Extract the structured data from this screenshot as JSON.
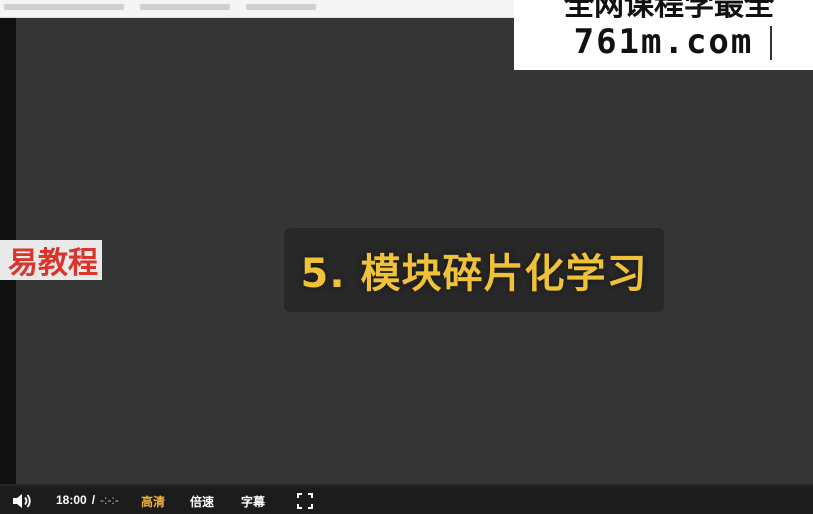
{
  "slide": {
    "title": "5. 模块碎片化学习"
  },
  "watermarks": {
    "left_text": "易教程",
    "right_top_text": "全网课程学最全",
    "right_bottom_text": "761m.com"
  },
  "controls": {
    "volume_icon": "speaker-icon",
    "current_time": "18:00",
    "separator": "/",
    "duration": "-:-:-",
    "quality_label": "高清",
    "speed_label": "倍速",
    "subtitle_label": "字幕",
    "fullscreen_icon": "fullscreen-icon",
    "accent_color": "#f0b43a"
  }
}
